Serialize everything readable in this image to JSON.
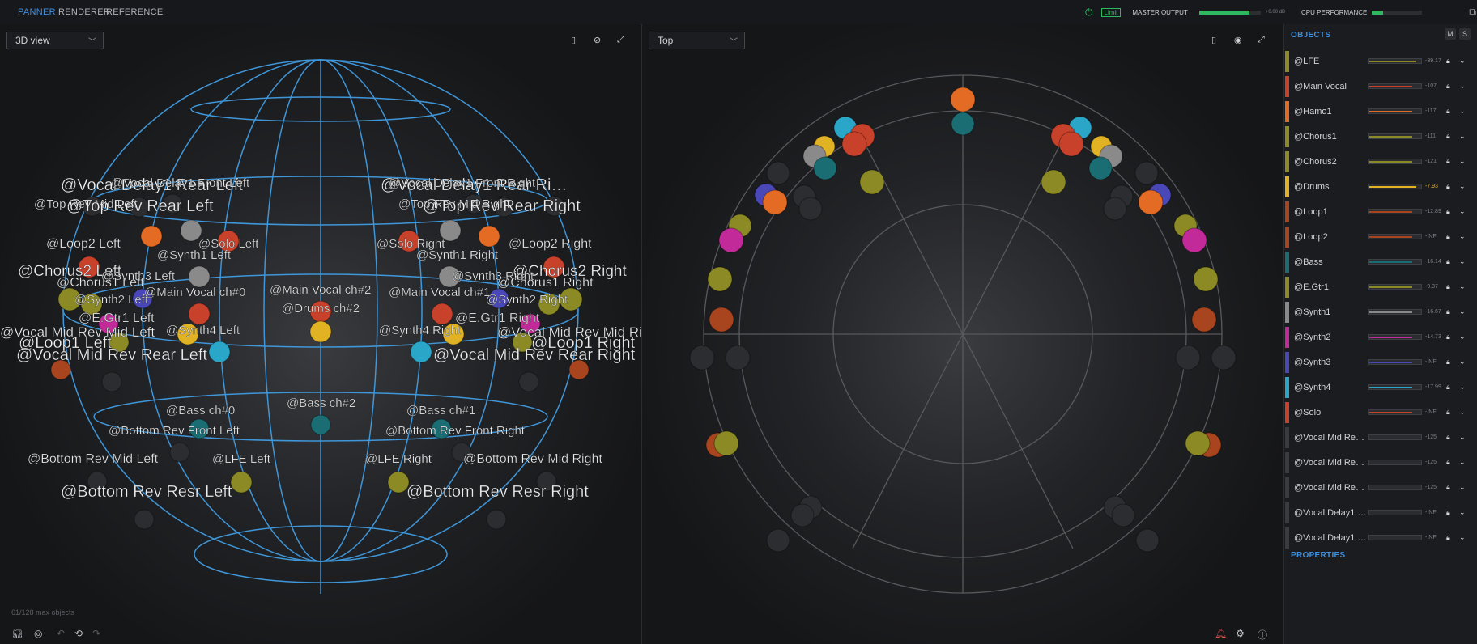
{
  "tabs": [
    {
      "label": "PANNER",
      "active": true
    },
    {
      "label": "RENDERER",
      "active": false
    },
    {
      "label": "REFERENCE",
      "active": false
    }
  ],
  "status": {
    "limit": "Limit",
    "master_output": "MASTER OUTPUT",
    "master_db": "+0.00 dB",
    "master_level": 0.82,
    "cpu": "CPU PERFORMANCE",
    "cpu_level": 0.22
  },
  "view3d": {
    "dropdown": "3D view",
    "footer": "61/128 max objects"
  },
  "viewtop": {
    "dropdown": "Top"
  },
  "labels3d": [
    "@Vocal Delay1 Rear Left",
    "@Vocal Delay1 Front Left",
    "@Top Rev Mid Left",
    "@Top Rev Rear Left",
    "@Vocal Delay1 Rear Ri…",
    "@Vocal Delay1 Front Right",
    "@Top Rev Mid Right",
    "@Top Rev Rear Right",
    "@Loop2 Left",
    "@Synth1 Left",
    "@Solo Left",
    "@Loop2 Right",
    "@Solo Right",
    "@Synth1 Right",
    "@Chorus2 Left",
    "@Synth3 Left",
    "@Chorus1 Left",
    "@Synth2 Left",
    "@Chorus2 Right",
    "@Synth3 Right",
    "@Chorus1 Right",
    "@Synth2 Right",
    "@Main Vocal ch#0",
    "@Main Vocal ch#2",
    "@Main Vocal ch#1",
    "@Drums ch#2",
    "@E.Gtr1 Left",
    "@E.Gtr1 Right",
    "@Synth4 Left",
    "@Synth4 Right",
    "@Vocal Mid Rev Mid Left",
    "@Vocal Mid Rev Mid Right",
    "@Loop1 Left",
    "@Loop1 Right",
    "@Vocal Mid Rev Rear Left",
    "@Vocal Mid Rev Rear Right",
    "@Bass ch#0",
    "@Bass ch#2",
    "@Bass ch#1",
    "@Bottom Rev Front Left",
    "@Bottom Rev Front Right",
    "@Bottom Rev Mid Left",
    "@Bottom Rev Mid Right",
    "@LFE Left",
    "@LFE Right",
    "@Bottom Rev Resr Left",
    "@Bottom Rev Resr Right"
  ],
  "objects_title": "OBJECTS",
  "m_label": "M",
  "s_label": "S",
  "properties_title": "PROPERTIES",
  "objects": [
    {
      "name": "@LFE",
      "db": "-39.17",
      "color": "#8c8a24",
      "level": 0.9
    },
    {
      "name": "@Main Vocal",
      "db": "-107",
      "color": "#c8412a",
      "level": 0.83
    },
    {
      "name": "@Hamo1",
      "db": "-117",
      "color": "#e36b24",
      "level": 0.83
    },
    {
      "name": "@Chorus1",
      "db": "-111",
      "color": "#8c8a24",
      "level": 0.83
    },
    {
      "name": "@Chorus2",
      "db": "-121",
      "color": "#8c8a24",
      "level": 0.83
    },
    {
      "name": "@Drums",
      "db": "-7.93",
      "color": "#e0b224",
      "level": 0.9
    },
    {
      "name": "@Loop1",
      "db": "-12.89",
      "color": "#a8441e",
      "level": 0.83
    },
    {
      "name": "@Loop2",
      "db": "-INF",
      "color": "#a8441e",
      "level": 0.83
    },
    {
      "name": "@Bass",
      "db": "-16.14",
      "color": "#1a6d72",
      "level": 0.83
    },
    {
      "name": "@E.Gtr1",
      "db": "-9.37",
      "color": "#8c8a24",
      "level": 0.83
    },
    {
      "name": "@Synth1",
      "db": "-16.67",
      "color": "#8a8a8a",
      "level": 0.83
    },
    {
      "name": "@Synth2",
      "db": "-14.73",
      "color": "#c22a9a",
      "level": 0.83
    },
    {
      "name": "@Synth3",
      "db": "-INF",
      "color": "#4a48b8",
      "level": 0.83
    },
    {
      "name": "@Synth4",
      "db": "-17.99",
      "color": "#2aa6c8",
      "level": 0.83
    },
    {
      "name": "@Solo",
      "db": "-INF",
      "color": "#c8412a",
      "level": 0.83
    },
    {
      "name": "@Vocal Mid Rev…",
      "db": "-125",
      "color": "#3a3b3e",
      "level": 0
    },
    {
      "name": "@Vocal Mid Rev…",
      "db": "-125",
      "color": "#3a3b3e",
      "level": 0
    },
    {
      "name": "@Vocal Mid Rev…",
      "db": "-125",
      "color": "#3a3b3e",
      "level": 0
    },
    {
      "name": "@Vocal Delay1 …",
      "db": "-INF",
      "color": "#3a3b3e",
      "level": 0
    },
    {
      "name": "@Vocal Delay1 …",
      "db": "-INF",
      "color": "#3a3b3e",
      "level": 0
    }
  ]
}
